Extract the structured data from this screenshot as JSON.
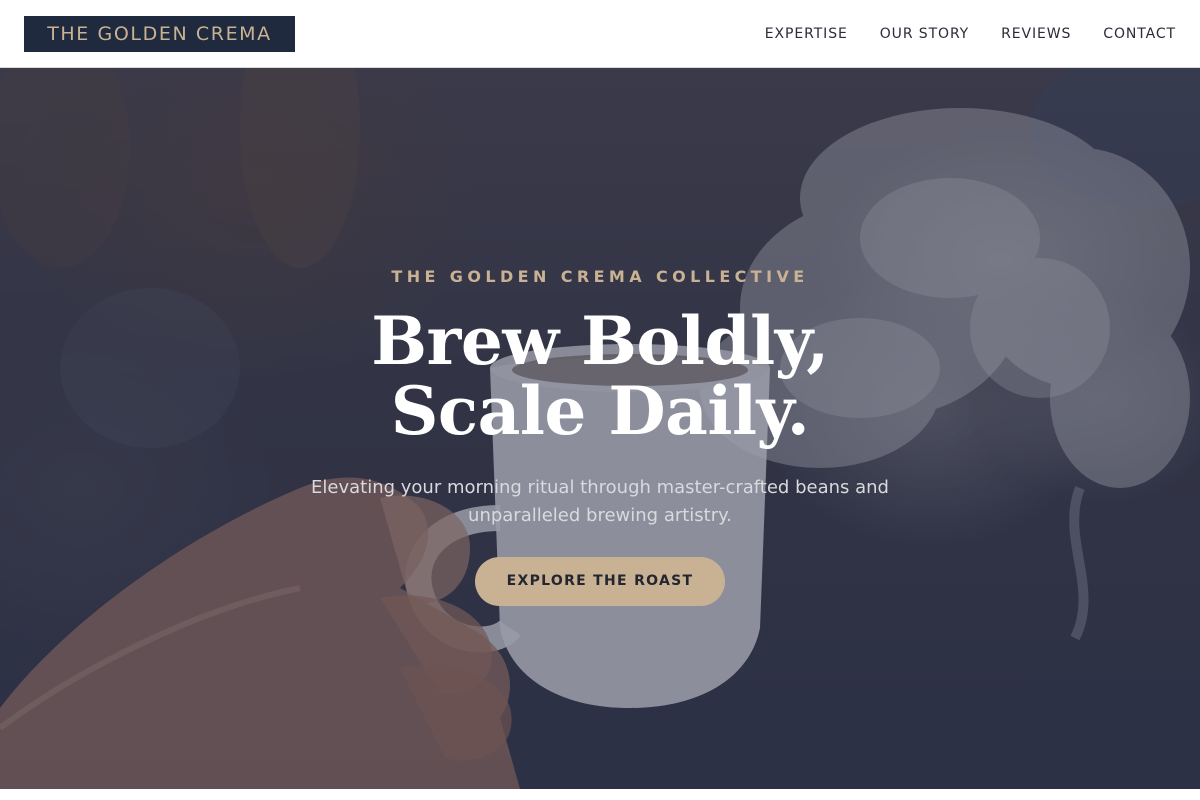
{
  "header": {
    "logo_text": "THE GOLDEN CREMA",
    "nav": [
      {
        "label": "EXPERTISE"
      },
      {
        "label": "OUR STORY"
      },
      {
        "label": "REVIEWS"
      },
      {
        "label": "CONTACT"
      }
    ]
  },
  "hero": {
    "eyebrow": "THE GOLDEN CREMA COLLECTIVE",
    "headline_line1": "Brew Boldly,",
    "headline_line2": "Scale Daily.",
    "subtitle": "Elevating your morning ritual through master-crafted beans and unparalleled brewing artistry.",
    "cta_label": "EXPLORE THE ROAST",
    "background_image": "hand-holding-steaming-coffee-cup"
  },
  "colors": {
    "navy": "#1f2a3f",
    "gold": "#c8b293",
    "white": "#ffffff",
    "text_dark": "#2a2d38"
  }
}
